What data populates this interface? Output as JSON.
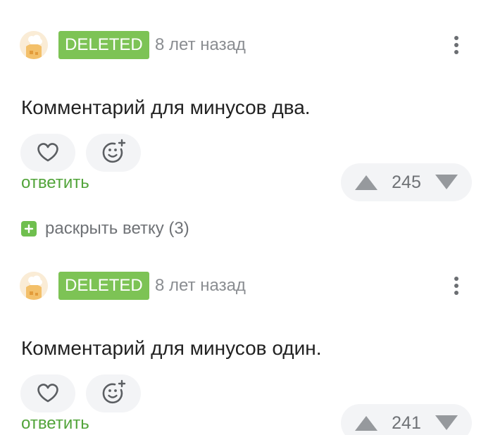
{
  "comments": [
    {
      "badge": "DELETED",
      "time": "8 лет назад",
      "text": "Комментарий для минусов два.",
      "reply_label": "ответить",
      "score": "245",
      "avatar_icon": "chef-avatar-icon"
    },
    {
      "badge": "DELETED",
      "time": "8 лет назад",
      "text": "Комментарий для минусов один.",
      "reply_label": "ответить",
      "score": "241",
      "avatar_icon": "chef-avatar-icon"
    }
  ],
  "expand_branch": {
    "label": "раскрыть ветку (3)",
    "icon": "plus-icon"
  },
  "icons": {
    "more": "more-vertical-icon",
    "like": "heart-icon",
    "react": "add-emoji-icon",
    "upvote": "upvote-icon",
    "downvote": "downvote-icon"
  },
  "colors": {
    "badge_green": "#7dc355",
    "reply_green": "#52a43a",
    "button_bg": "#f3f4f6",
    "muted_text": "#8a8d91"
  }
}
